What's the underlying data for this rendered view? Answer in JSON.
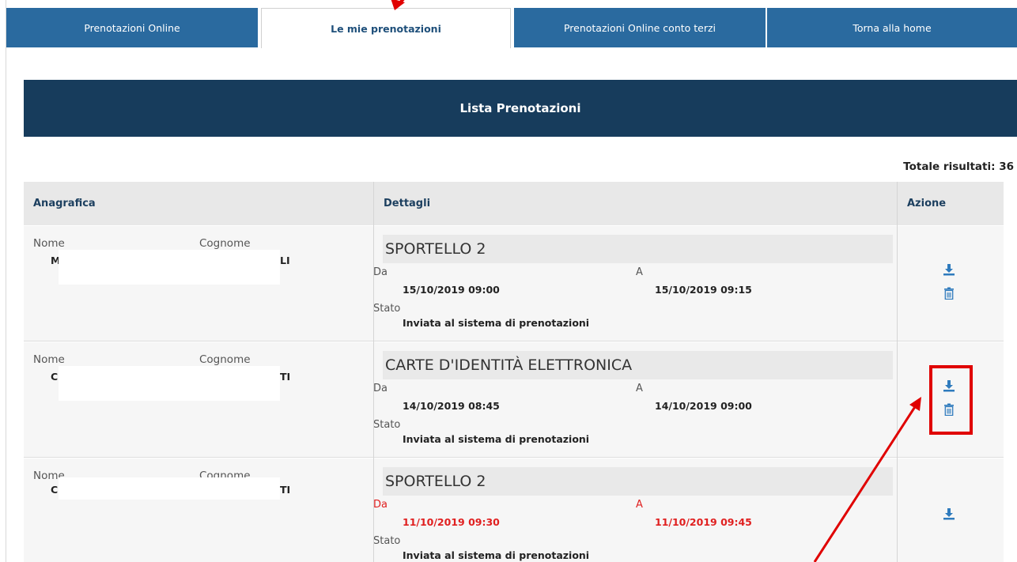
{
  "tabs": [
    {
      "label": "Prenotazioni Online"
    },
    {
      "label": "Le mie prenotazioni"
    },
    {
      "label": "Prenotazioni Online conto terzi"
    },
    {
      "label": "Torna alla home"
    }
  ],
  "banner": {
    "title": "Lista Prenotazioni"
  },
  "totals": {
    "text": "Totale risultati: 36"
  },
  "table": {
    "headers": [
      "Anagrafica",
      "Dettagli",
      "Azione"
    ],
    "labels": {
      "nome": "Nome",
      "cognome": "Cognome",
      "da": "Da",
      "a": "A",
      "stato": "Stato"
    },
    "rows": [
      {
        "nome": "M",
        "cognome": "LI",
        "servizio": "SPORTELLO 2",
        "da": "15/10/2019 09:00",
        "a": "15/10/2019 09:15",
        "stato": "Inviata al sistema di prenotazioni",
        "actions": [
          "download-icon",
          "trash-icon"
        ]
      },
      {
        "nome": "C",
        "cognome": "TI",
        "servizio": "CARTE D'IDENTITÀ ELETTRONICA",
        "da": "14/10/2019 08:45",
        "a": "14/10/2019 09:00",
        "stato": "Inviata al sistema di prenotazioni",
        "actions": [
          "download-icon",
          "trash-icon"
        ]
      },
      {
        "nome": "CR",
        "cognome": "TI",
        "servizio": "SPORTELLO 2",
        "da": "11/10/2019 09:30",
        "a": "11/10/2019 09:45",
        "stato": "Inviata al sistema di prenotazioni",
        "actions": [
          "download-icon"
        ]
      }
    ]
  },
  "colors": {
    "tab": "#2a6a9f",
    "banner": "#173c5c",
    "highlight": "#e02020",
    "annotation": "#e00000"
  }
}
